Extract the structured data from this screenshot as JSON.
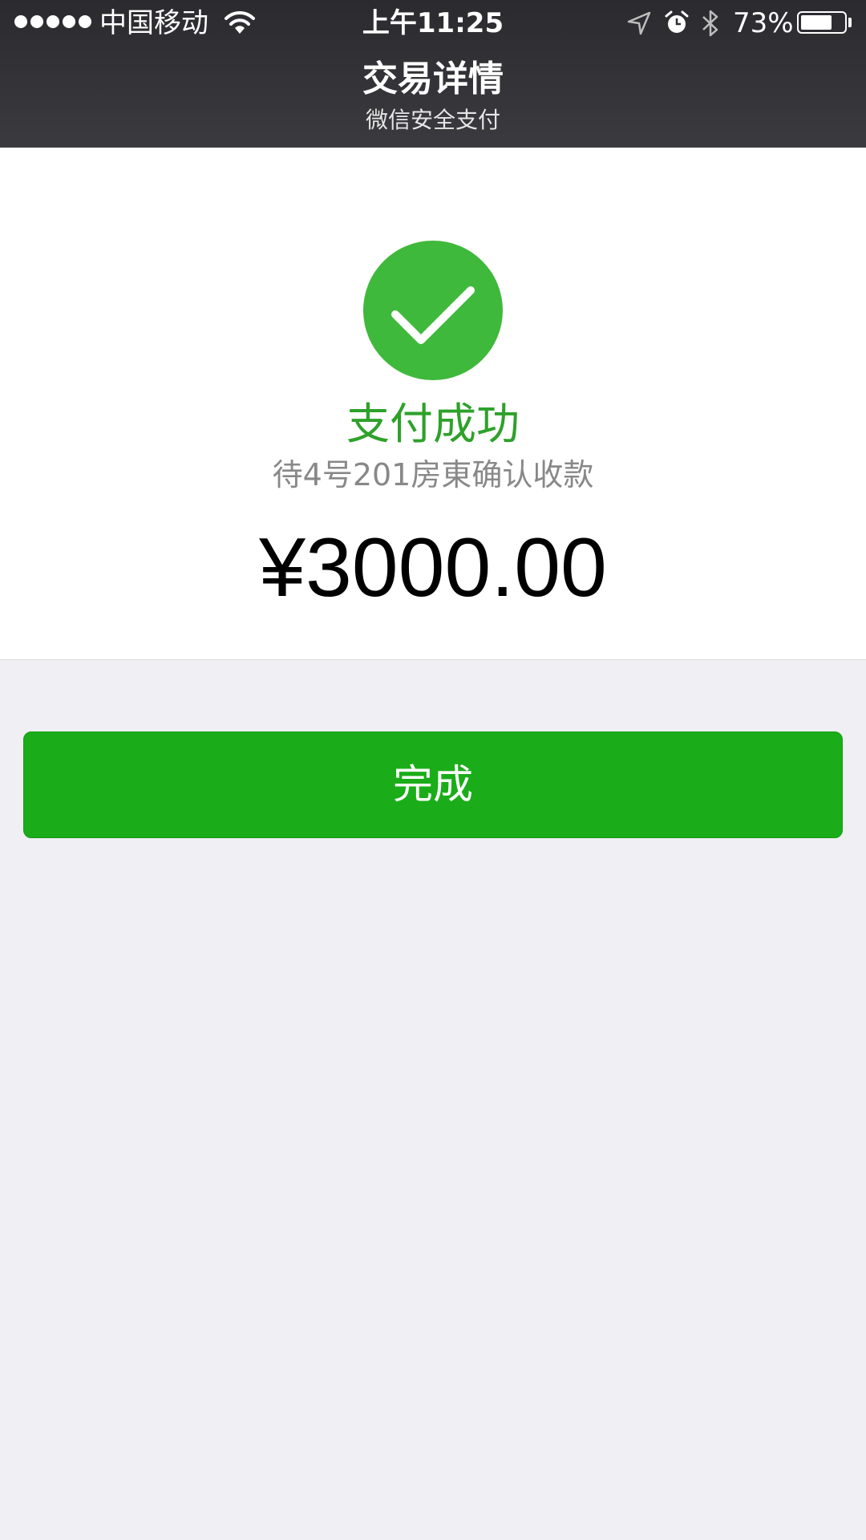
{
  "status_bar": {
    "carrier": "中国移动",
    "time": "上午11:25",
    "battery_percent": "73%",
    "battery_level": 0.73,
    "signal_bars": 5,
    "icons": [
      "wifi-icon",
      "location-arrow-icon",
      "alarm-icon",
      "bluetooth-icon",
      "battery-icon"
    ]
  },
  "nav": {
    "title": "交易详情",
    "subtitle": "微信安全支付"
  },
  "result": {
    "icon": "checkmark-icon",
    "status": "支付成功",
    "note": "待4号201房東确认收款",
    "amount": "¥3000.00"
  },
  "actions": {
    "done_label": "完成"
  },
  "colors": {
    "header_bg": "#2f2f33",
    "success_green": "#3fb93b",
    "status_text_green": "#2ea12a",
    "button_green": "#1aad19",
    "page_bg": "#efeff4"
  }
}
